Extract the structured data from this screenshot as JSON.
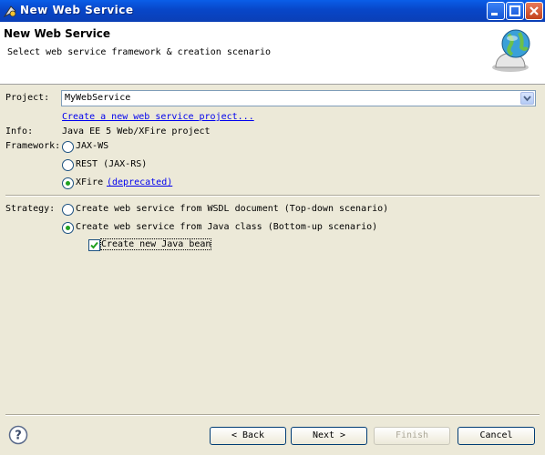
{
  "window": {
    "title": "New Web Service"
  },
  "header": {
    "title": "New Web Service",
    "description": "Select web service framework & creation scenario"
  },
  "project": {
    "label": "Project:",
    "value": "MyWebService",
    "create_link": "Create a new web service project..."
  },
  "info": {
    "label": "Info:",
    "value": "Java EE 5 Web/XFire project"
  },
  "framework": {
    "label": "Framework:",
    "options": [
      {
        "label": "JAX-WS",
        "checked": false
      },
      {
        "label": "REST (JAX-RS)",
        "checked": false
      },
      {
        "label": "XFire",
        "checked": true,
        "note": "(deprecated)"
      }
    ]
  },
  "strategy": {
    "label": "Strategy:",
    "options": [
      {
        "label": "Create web service from WSDL document (Top-down scenario)",
        "checked": false
      },
      {
        "label": "Create web service from Java class (Bottom-up scenario)",
        "checked": true
      }
    ],
    "create_bean": {
      "label": "Create new Java bean",
      "checked": true
    }
  },
  "buttons": {
    "back": "< Back",
    "next": "Next >",
    "finish": "Finish",
    "cancel": "Cancel"
  },
  "colors": {
    "titlebar": "#0846c8",
    "link": "#0000ee",
    "radio_checked": "#21a121",
    "dialog_bg": "#ece9d8"
  }
}
